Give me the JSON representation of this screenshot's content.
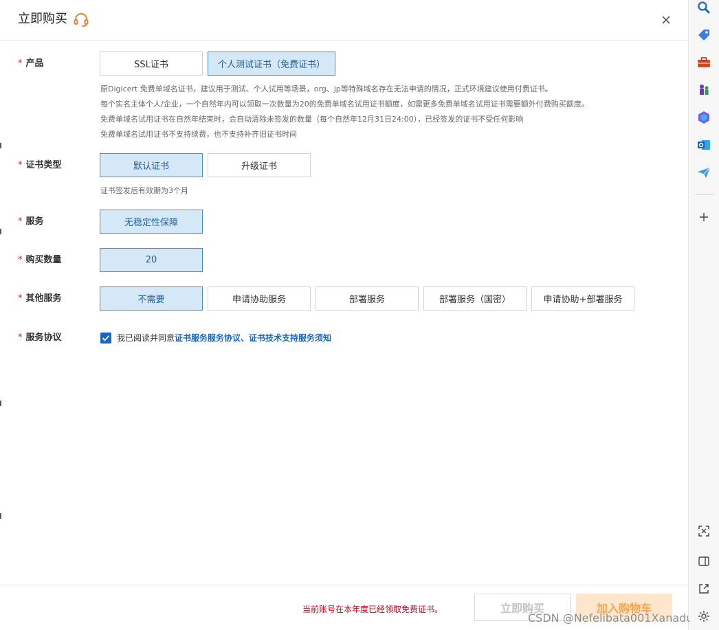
{
  "dialog": {
    "title": "立即购买",
    "close_label": "×"
  },
  "rows": {
    "product": {
      "label": "产品",
      "options": [
        "SSL证书",
        "个人测试证书（免费证书）"
      ],
      "selected": 1,
      "desc": [
        "原Digicert 免费单域名证书，建议用于测试、个人试用等场景，org、jp等特殊域名存在无法申请的情况，正式环境建议使用付费证书。",
        "每个实名主体个人/企业，一个自然年内可以领取一次数量为20的免费单域名试用证书额度，如需更多免费单域名试用证书需要额外付费购买额度。",
        "免费单域名试用证书在自然年结束时，会自动清除未签发的数量（每个自然年12月31日24:00），已经签发的证书不受任何影响",
        "免费单域名试用证书不支持续费，也不支持补齐旧证书时间"
      ]
    },
    "cert_type": {
      "label": "证书类型",
      "options": [
        "默认证书",
        "升级证书"
      ],
      "selected": 0,
      "desc": "证书签发后有效期为3个月"
    },
    "service": {
      "label": "服务",
      "options": [
        "无稳定性保障"
      ],
      "selected": 0
    },
    "quantity": {
      "label": "购买数量",
      "value": "20"
    },
    "other_service": {
      "label": "其他服务",
      "options": [
        "不需要",
        "申请协助服务",
        "部署服务",
        "部署服务（国密）",
        "申请协助+部署服务"
      ],
      "selected": 0
    },
    "agreement": {
      "label": "服务协议",
      "checked": true,
      "text": "我已阅读并同意",
      "links": "证书服务服务协议、证书技术支持服务须知"
    }
  },
  "footer": {
    "notice": "当前账号在本年度已经领取免费证书。",
    "buy_now": "立即购买",
    "add_to_cart": "加入购物车"
  },
  "watermark": "CSDN @Nefelibata001Xanadu",
  "colors": {
    "accent": "#1a66c2",
    "selected_bg": "#d5e8f7",
    "selected_border": "#3d8fd1",
    "required": "#e02020",
    "notice": "#d0021b",
    "cart_bg": "#fde6cb",
    "cart_text": "#f5a54a"
  },
  "sidebar_icons": [
    "search-icon",
    "tag-icon",
    "toolbox-icon",
    "chess-icon",
    "copilot-icon",
    "outlook-icon",
    "send-icon",
    "add-icon",
    "screenshot-icon",
    "split-view-icon",
    "external-link-icon",
    "settings-icon"
  ]
}
